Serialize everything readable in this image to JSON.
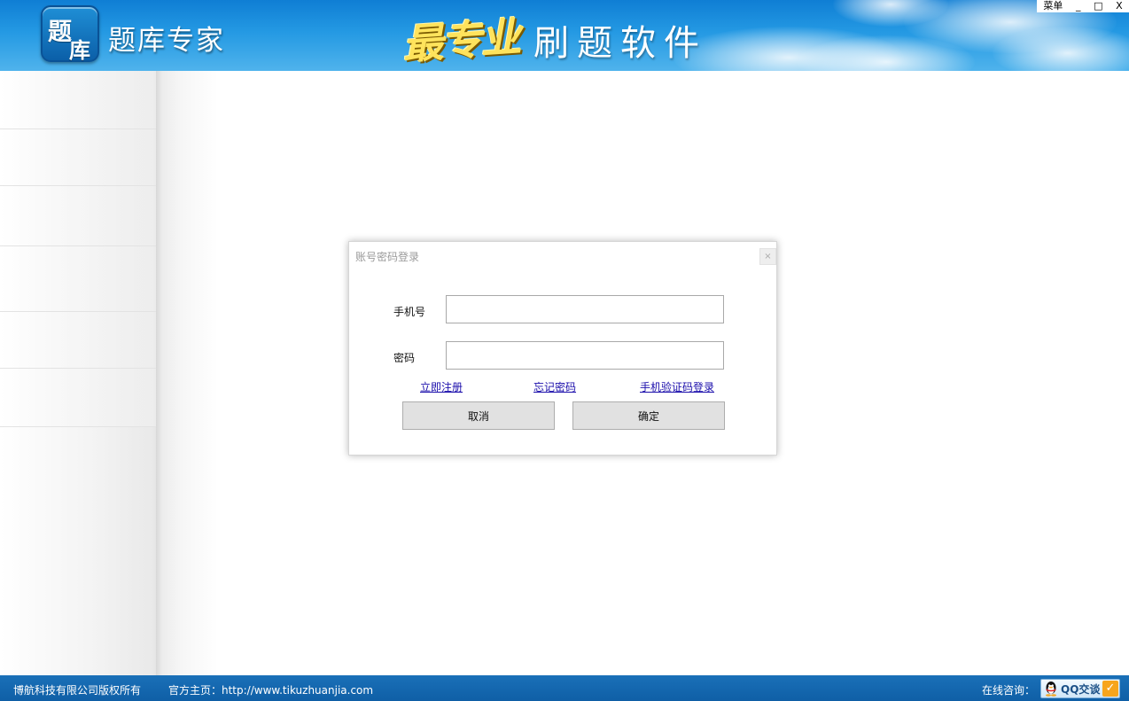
{
  "header": {
    "logo_char_1": "题",
    "logo_char_2": "库",
    "app_name": "题库专家",
    "slogan_hand": "最专业",
    "slogan_text": "刷题软件"
  },
  "window_controls": {
    "menu": "菜单",
    "minimize": "_",
    "maximize": "□",
    "close": "X"
  },
  "login_dialog": {
    "title": "账号密码登录",
    "close": "×",
    "phone_label": "手机号",
    "phone_value": "",
    "password_label": "密码",
    "password_value": "",
    "links": {
      "register": "立即注册",
      "forgot_password": "忘记密码",
      "sms_login": "手机验证码登录"
    },
    "cancel_label": "取消",
    "confirm_label": "确定"
  },
  "footer": {
    "copyright": "博航科技有限公司版权所有",
    "homepage": "官方主页：http://www.tikuzhuanjia.com",
    "online_consult": "在线咨询：",
    "qq_button": "QQ交谈",
    "qq_check": "✓"
  },
  "colors": {
    "header_blue": "#2499e3",
    "footer_blue": "#0f5fa6",
    "link_blue": "#1a0dab",
    "slogan_yellow": "#ffe35c"
  }
}
